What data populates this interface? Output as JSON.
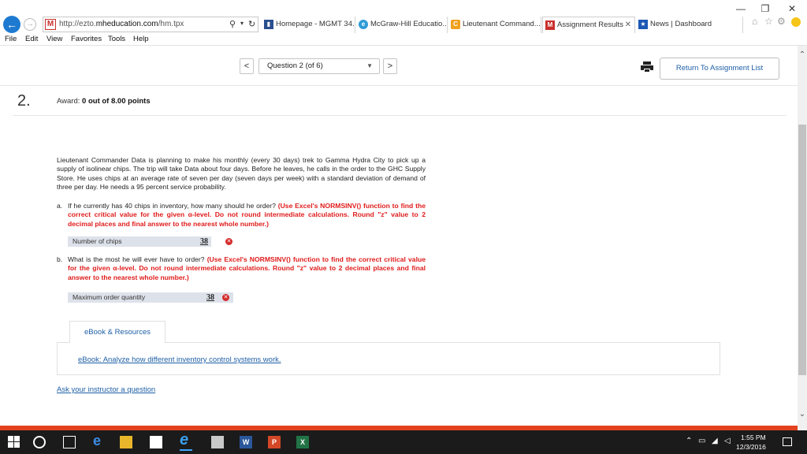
{
  "window": {
    "minimize": "—",
    "restore": "❐",
    "close": "✕"
  },
  "address": {
    "url_prefix": "http://ezto.",
    "url_domain": "mheducation.com",
    "url_suffix": "/hm.tpx",
    "logo": "M"
  },
  "tabs": [
    {
      "label": "Homepage - MGMT 34...",
      "icon": "bookmark-icon",
      "glyph": "▮"
    },
    {
      "label": "McGraw-Hill Educatio...",
      "icon": "ie-icon",
      "glyph": "e"
    },
    {
      "label": "Lieutenant Command...",
      "icon": "chegg-icon",
      "glyph": "C"
    },
    {
      "label": "Assignment Results",
      "icon": "mheducation-icon",
      "glyph": "M",
      "close": "✕"
    },
    {
      "label": "News | Dashboard",
      "icon": "star-badge-icon",
      "glyph": "★"
    }
  ],
  "menu": [
    "File",
    "Edit",
    "View",
    "Favorites",
    "Tools",
    "Help"
  ],
  "question_nav": {
    "prev": "<",
    "next": ">",
    "selected": "Question 2 (of 6)",
    "caret": "▼"
  },
  "return_button": "Return To Assignment List",
  "question": {
    "number": "2.",
    "award_prefix": "Award: ",
    "award_value": "0 out of 8.00 points",
    "body": "Lieutenant Commander Data is planning to make his monthly (every 30 days) trek to Gamma Hydra City to pick up a supply of isolinear chips. The trip will take Data about four days. Before he leaves, he calls in the order to the GHC Supply Store. He uses chips at an average rate of seven per day (seven days per week) with a standard deviation of demand of three per day. He needs a 95 percent service probability.",
    "part_a": {
      "label": "a.",
      "text": "If he currently has 40 chips in inventory, how many should he order?",
      "instruction": "(Use Excel's NORMSINV() function to find the correct critical value for the given α-level. Do not round intermediate calculations. Round \"z\" value to 2 decimal places and final answer to the nearest whole number.)",
      "answer_label": "Number of chips",
      "answer_value": "38",
      "status": "incorrect"
    },
    "part_b": {
      "label": "b.",
      "text": "What is the most he will ever have to order?",
      "instruction": "(Use Excel's NORMSINV() function to find the correct critical value for the given α-level. Do not round intermediate calculations. Round \"z\" value to 2 decimal places and final answer to the nearest whole number.)",
      "answer_label": "Maximum order quantity",
      "answer_value": "38",
      "status": "incorrect"
    }
  },
  "resources": {
    "tab": "eBook & Resources",
    "link": "eBook: Analyze how different inventory control systems work."
  },
  "ask_link": "Ask your instructor a question",
  "taskbar": {
    "word": "W",
    "powerpoint": "P",
    "excel": "X",
    "time": "1:55 PM",
    "date": "12/3/2016"
  },
  "colors": {
    "accent_link": "#1e5fa6",
    "incorrect": "#d42a2a",
    "instruction_red": "#e01b1b",
    "brand_band": "#e3421e"
  }
}
